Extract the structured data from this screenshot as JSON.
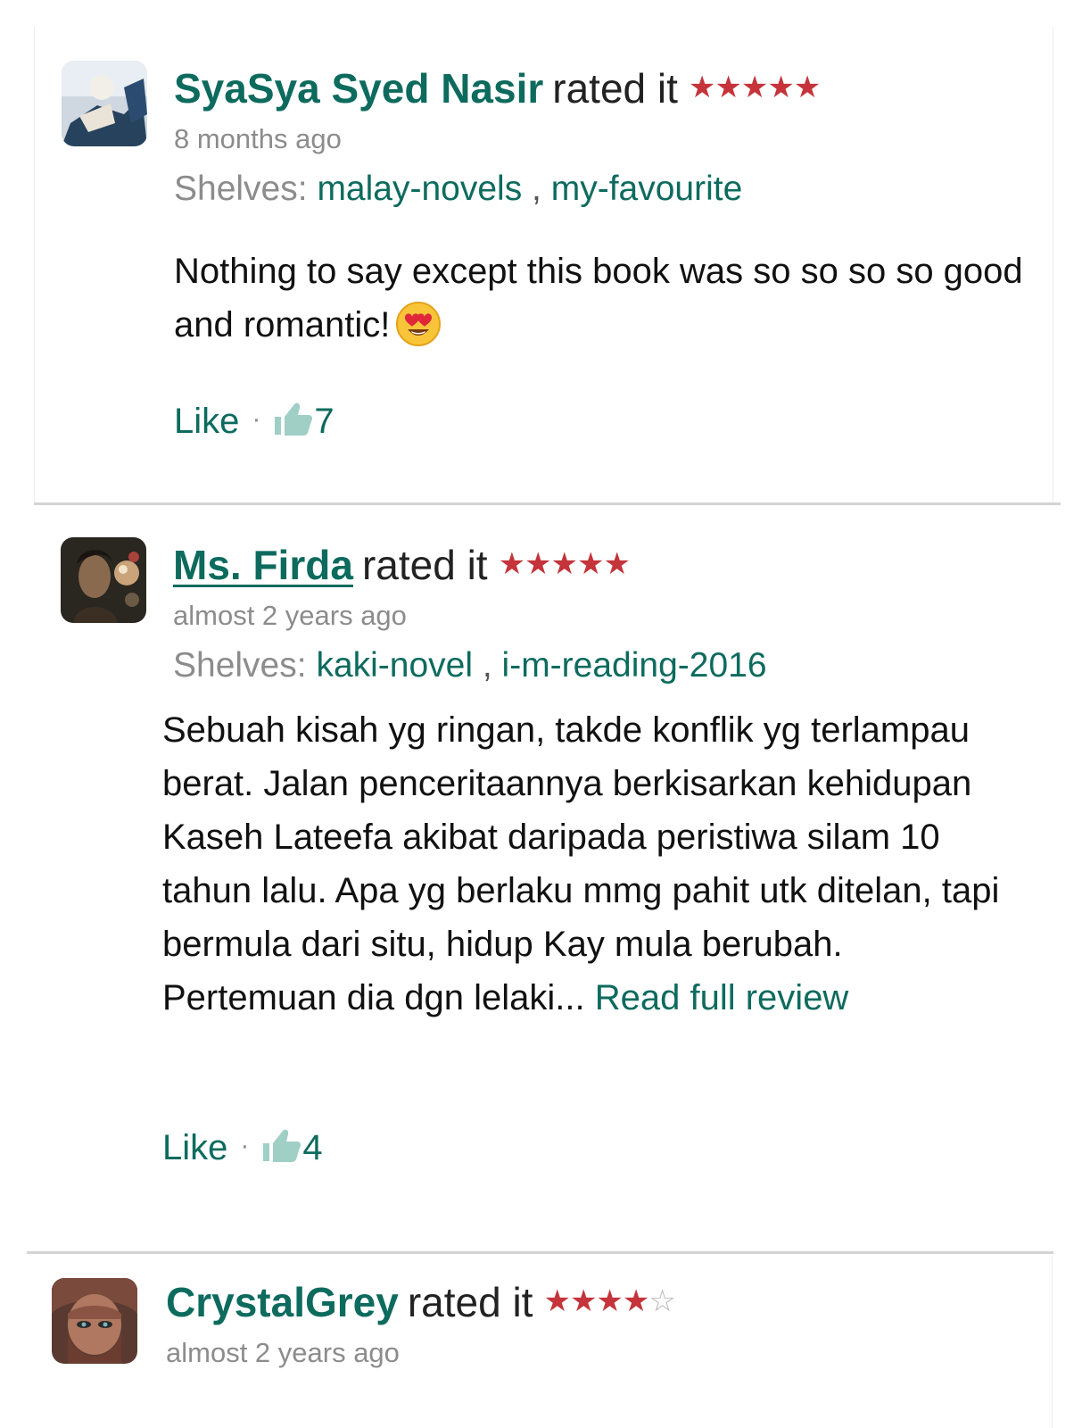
{
  "reviews": [
    {
      "user_name": "SyaSya Syed Nasir",
      "rated_text": "rated it",
      "stars": "★★★★★",
      "empty_stars": "",
      "rating": 5,
      "date": "8 months ago",
      "shelves_label": "Shelves:",
      "shelves": [
        "malay-novels",
        "my-favourite"
      ],
      "shelf_separator": ",",
      "text": "Nothing to say except this book was so so so so good and romantic!",
      "emoji": "smiling-face-with-heart-eyes",
      "like_label": "Like",
      "like_separator": "·",
      "like_count": "7"
    },
    {
      "user_name": "Ms. Firda",
      "rated_text": "rated it",
      "stars": "★★★★★",
      "empty_stars": "",
      "rating": 5,
      "date": "almost 2 years ago",
      "shelves_label": "Shelves:",
      "shelves": [
        "kaki-novel",
        "i-m-reading-2016"
      ],
      "shelf_separator": ",",
      "text": "Sebuah kisah yg ringan, takde konflik yg terlampau berat. Jalan penceritaannya berkisarkan kehidupan Kaseh Lateefa akibat daripada peristiwa silam 10 tahun lalu. Apa yg berlaku mmg pahit utk ditelan, tapi bermula dari situ, hidup Kay mula berubah. Pertemuan dia dgn lelaki...",
      "read_full": "Read full review",
      "like_label": "Like",
      "like_separator": "·",
      "like_count": "4"
    },
    {
      "user_name": "CrystalGrey",
      "rated_text": "rated it",
      "stars": "★★★★",
      "empty_stars": "☆",
      "rating": 4,
      "date": "almost 2 years ago"
    }
  ],
  "colors": {
    "link": "#0d6b5e",
    "star": "#c4343a",
    "muted": "#8c8c8c",
    "divider": "#d4d4d4"
  },
  "icons": [
    "user-avatar",
    "star-icon",
    "heart-eyes-emoji-icon",
    "thumbs-up-icon"
  ]
}
